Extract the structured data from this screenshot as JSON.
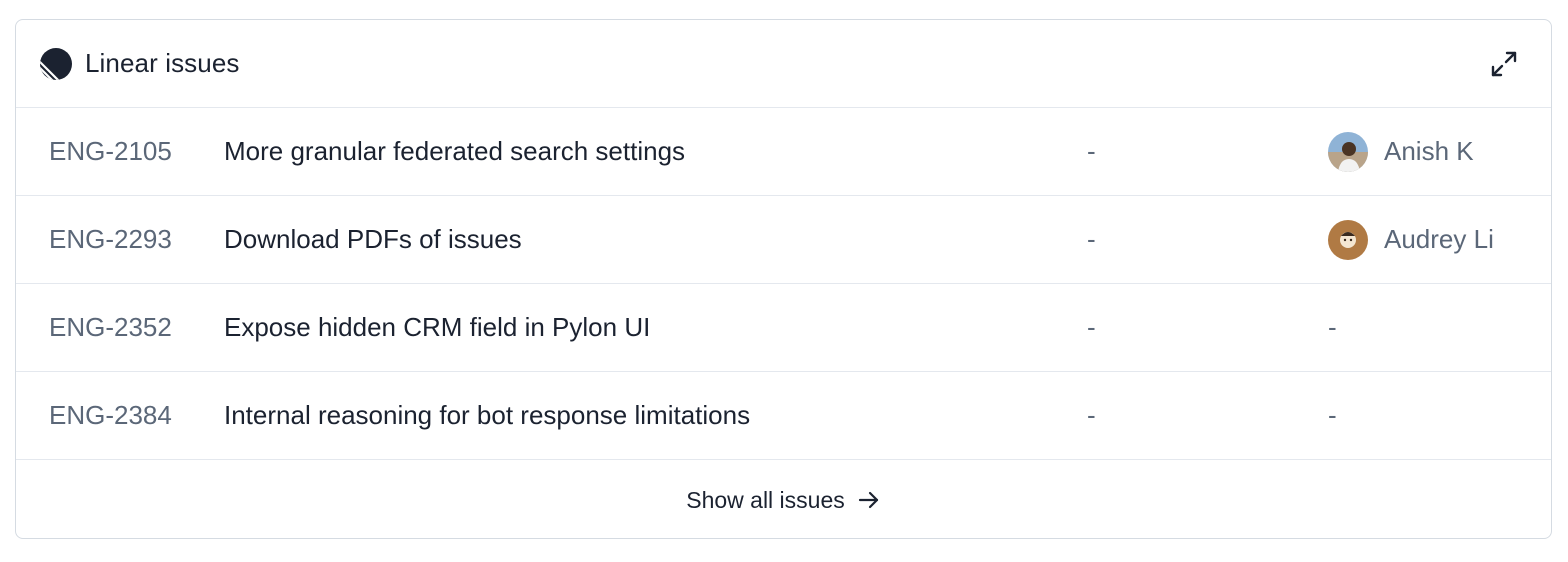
{
  "header": {
    "title": "Linear issues",
    "logo_icon": "linear-logo-icon",
    "expand_icon": "expand-icon"
  },
  "issues": [
    {
      "id": "ENG-2105",
      "title": "More granular federated search settings",
      "status": "-",
      "assignee": "Anish K",
      "has_avatar": true
    },
    {
      "id": "ENG-2293",
      "title": "Download PDFs of issues",
      "status": "-",
      "assignee": "Audrey Li",
      "has_avatar": true
    },
    {
      "id": "ENG-2352",
      "title": "Expose hidden CRM field in Pylon UI",
      "status": "-",
      "assignee": "-",
      "has_avatar": false
    },
    {
      "id": "ENG-2384",
      "title": "Internal reasoning for bot response limitations",
      "status": "-",
      "assignee": "-",
      "has_avatar": false
    }
  ],
  "footer": {
    "label": "Show all issues",
    "icon": "arrow-right-icon"
  },
  "colors": {
    "border": "#d5dbe2",
    "text_primary": "#1b2230",
    "text_secondary": "#5b6778"
  }
}
